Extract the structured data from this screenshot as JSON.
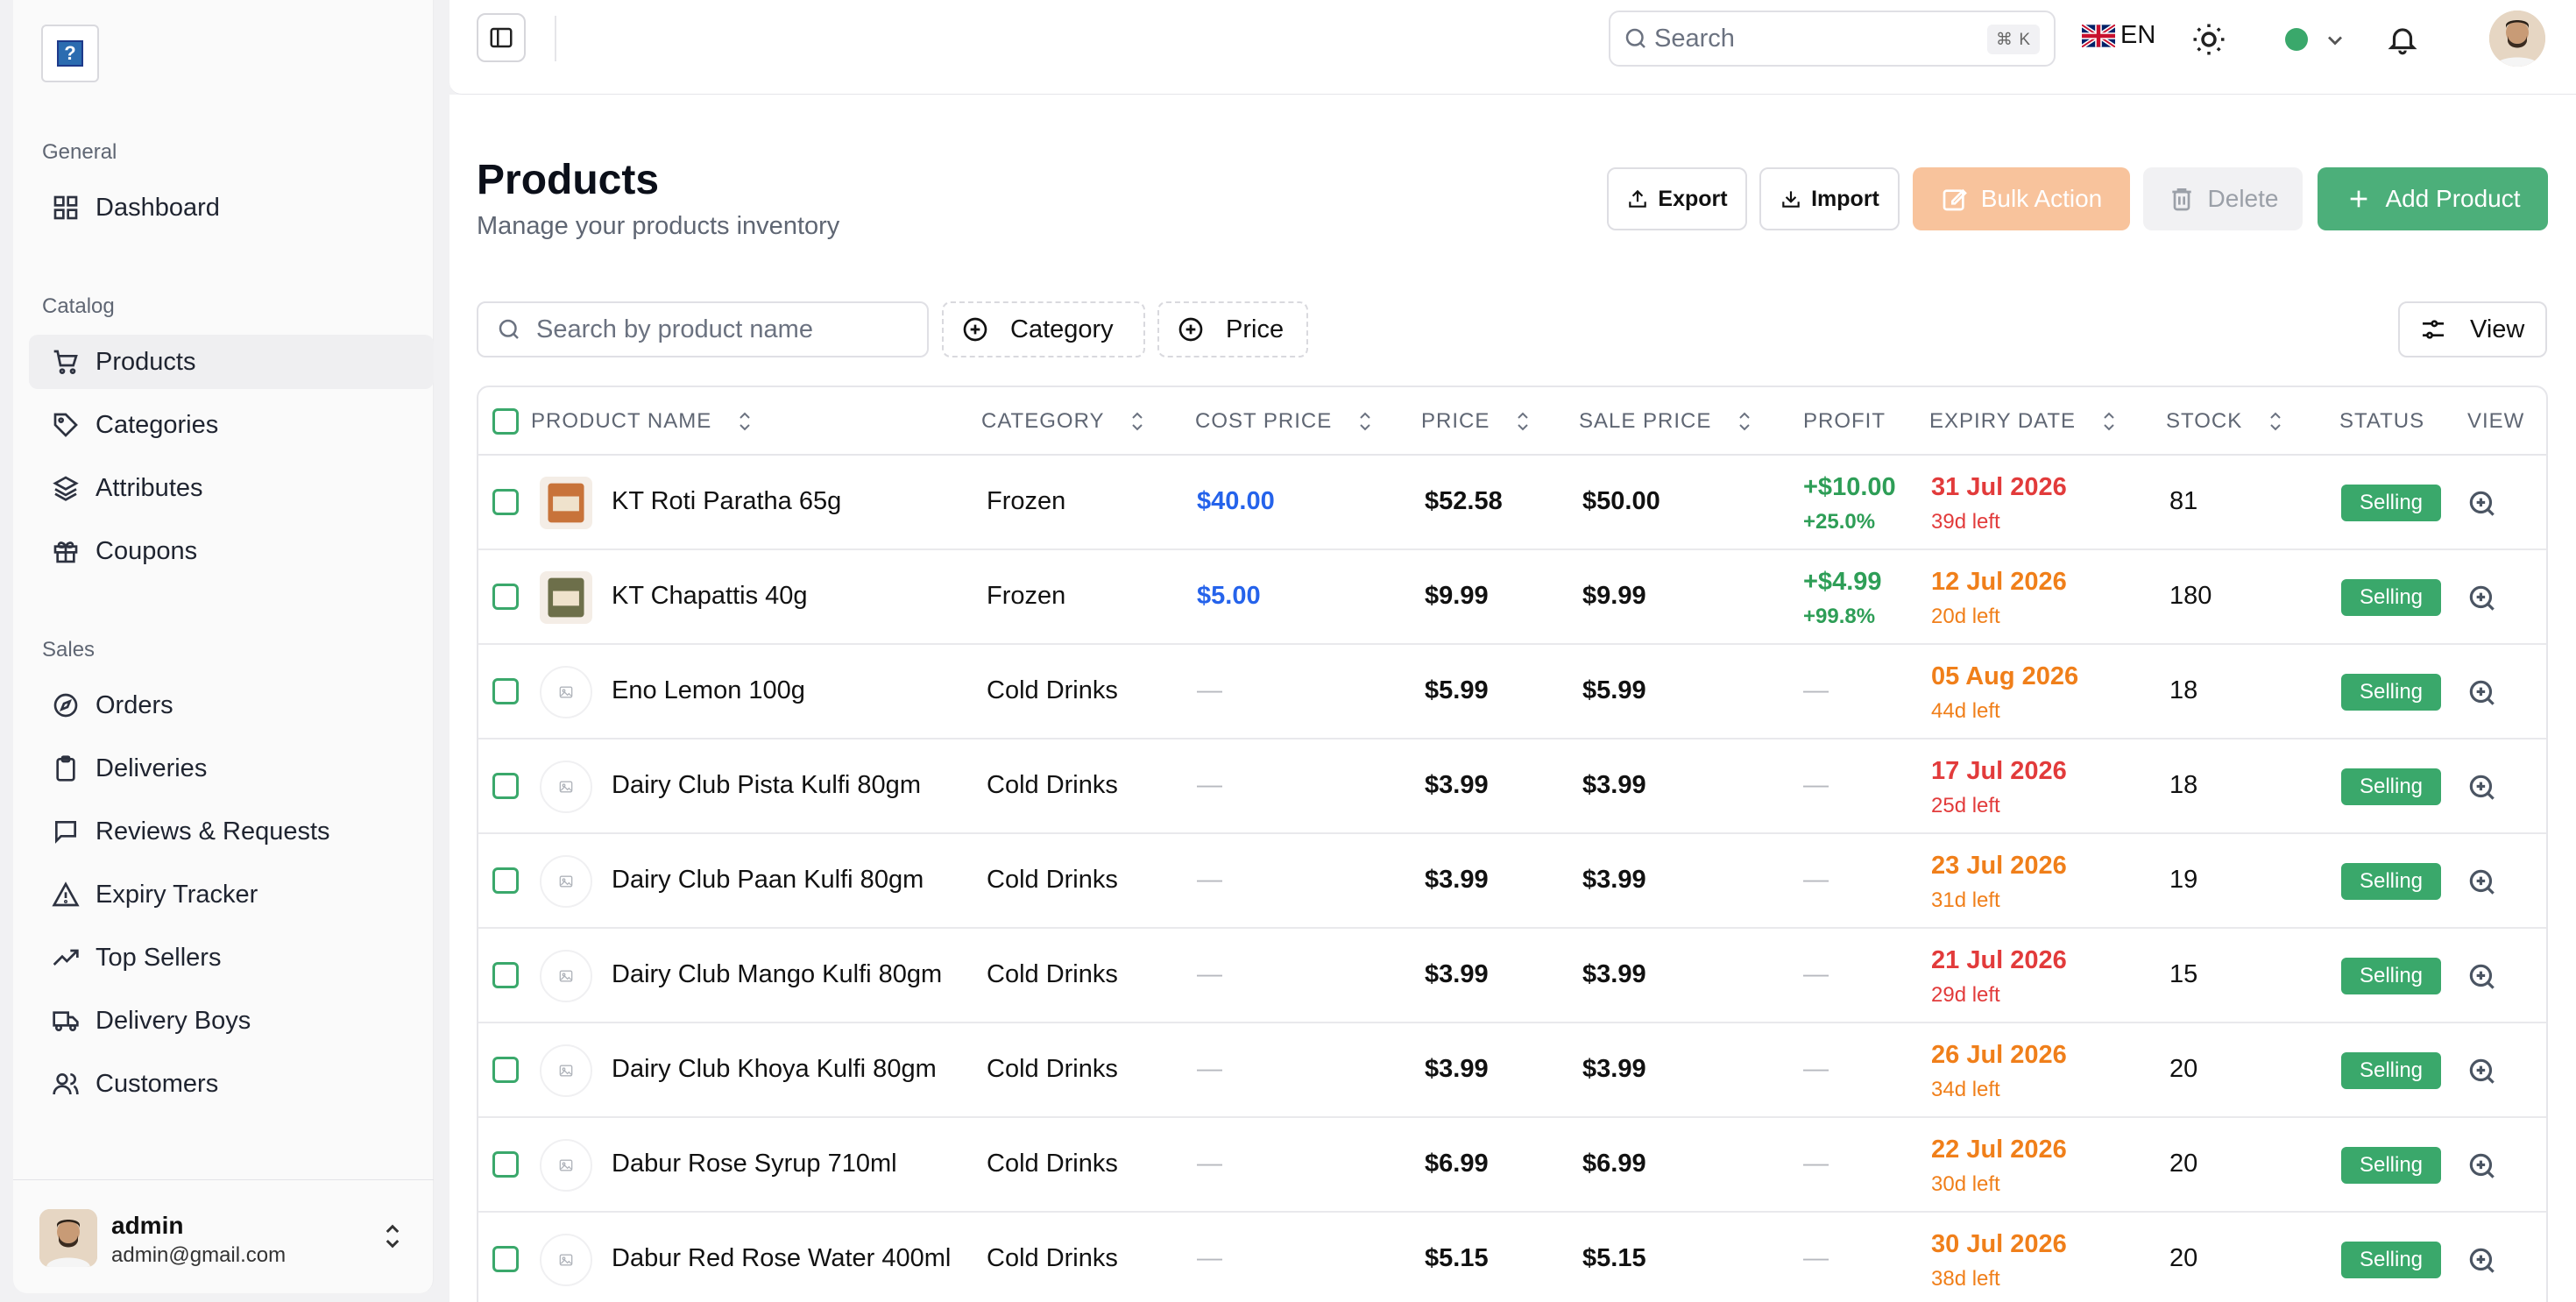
{
  "sidebar": {
    "groups": {
      "general": "General",
      "catalog": "Catalog",
      "sales": "Sales"
    },
    "items": [
      {
        "label": "Dashboard",
        "icon": "dashboard-icon"
      },
      {
        "label": "Products",
        "icon": "cart-icon"
      },
      {
        "label": "Categories",
        "icon": "tag-icon"
      },
      {
        "label": "Attributes",
        "icon": "layers-icon"
      },
      {
        "label": "Coupons",
        "icon": "gift-icon"
      },
      {
        "label": "Orders",
        "icon": "compass-icon"
      },
      {
        "label": "Deliveries",
        "icon": "clipboard-icon"
      },
      {
        "label": "Reviews & Requests",
        "icon": "message-icon"
      },
      {
        "label": "Expiry Tracker",
        "icon": "warning-icon"
      },
      {
        "label": "Top Sellers",
        "icon": "trending-up-icon"
      },
      {
        "label": "Delivery Boys",
        "icon": "truck-icon"
      },
      {
        "label": "Customers",
        "icon": "users-icon"
      }
    ],
    "user": {
      "name": "admin",
      "email": "admin@gmail.com"
    }
  },
  "topbar": {
    "search_placeholder": "Search",
    "shortcut": "⌘ K",
    "language": "EN",
    "status_color": "#3aa86b"
  },
  "page": {
    "title": "Products",
    "subtitle": "Manage your products inventory"
  },
  "actions": {
    "export": "Export",
    "import": "Import",
    "bulk": "Bulk Action",
    "delete": "Delete",
    "add": "Add Product"
  },
  "filters": {
    "search_placeholder": "Search by product name",
    "category": "Category",
    "price": "Price",
    "view": "View"
  },
  "table": {
    "headers": {
      "name": "PRODUCT NAME",
      "category": "CATEGORY",
      "cost": "COST PRICE",
      "price": "PRICE",
      "sale": "SALE PRICE",
      "profit": "PROFIT",
      "expiry": "EXPIRY DATE",
      "stock": "STOCK",
      "status": "STATUS",
      "view": "VIEW"
    },
    "rows": [
      {
        "name": "KT Roti Paratha 65g",
        "category": "Frozen",
        "cost": "$40.00",
        "price": "$52.58",
        "sale": "$50.00",
        "profit": "+$10.00",
        "profit_pct": "+25.0%",
        "expiry": "31 Jul 2026",
        "left": "39d left",
        "stock": "81",
        "status": "Selling"
      },
      {
        "name": "KT Chapattis 40g",
        "category": "Frozen",
        "cost": "$5.00",
        "price": "$9.99",
        "sale": "$9.99",
        "profit": "+$4.99",
        "profit_pct": "+99.8%",
        "expiry": "12 Jul 2026",
        "left": "20d left",
        "stock": "180",
        "status": "Selling"
      },
      {
        "name": "Eno Lemon 100g",
        "category": "Cold Drinks",
        "cost": "—",
        "price": "$5.99",
        "sale": "$5.99",
        "profit": "—",
        "profit_pct": "",
        "expiry": "05 Aug 2026",
        "left": "44d left",
        "stock": "18",
        "status": "Selling"
      },
      {
        "name": "Dairy Club Pista Kulfi 80gm",
        "category": "Cold Drinks",
        "cost": "—",
        "price": "$3.99",
        "sale": "$3.99",
        "profit": "—",
        "profit_pct": "",
        "expiry": "17 Jul 2026",
        "left": "25d left",
        "stock": "18",
        "status": "Selling"
      },
      {
        "name": "Dairy Club Paan Kulfi 80gm",
        "category": "Cold Drinks",
        "cost": "—",
        "price": "$3.99",
        "sale": "$3.99",
        "profit": "—",
        "profit_pct": "",
        "expiry": "23 Jul 2026",
        "left": "31d left",
        "stock": "19",
        "status": "Selling"
      },
      {
        "name": "Dairy Club Mango Kulfi 80gm",
        "category": "Cold Drinks",
        "cost": "—",
        "price": "$3.99",
        "sale": "$3.99",
        "profit": "—",
        "profit_pct": "",
        "expiry": "21 Jul 2026",
        "left": "29d left",
        "stock": "15",
        "status": "Selling"
      },
      {
        "name": "Dairy Club Khoya Kulfi 80gm",
        "category": "Cold Drinks",
        "cost": "—",
        "price": "$3.99",
        "sale": "$3.99",
        "profit": "—",
        "profit_pct": "",
        "expiry": "26 Jul 2026",
        "left": "34d left",
        "stock": "20",
        "status": "Selling"
      },
      {
        "name": "Dabur Rose Syrup 710ml",
        "category": "Cold Drinks",
        "cost": "—",
        "price": "$6.99",
        "sale": "$6.99",
        "profit": "—",
        "profit_pct": "",
        "expiry": "22 Jul 2026",
        "left": "30d left",
        "stock": "20",
        "status": "Selling"
      },
      {
        "name": "Dabur Red Rose Water 400ml",
        "category": "Cold Drinks",
        "cost": "—",
        "price": "$5.15",
        "sale": "$5.15",
        "profit": "—",
        "profit_pct": "",
        "expiry": "30 Jul 2026",
        "left": "38d left",
        "stock": "20",
        "status": "Selling"
      }
    ]
  }
}
